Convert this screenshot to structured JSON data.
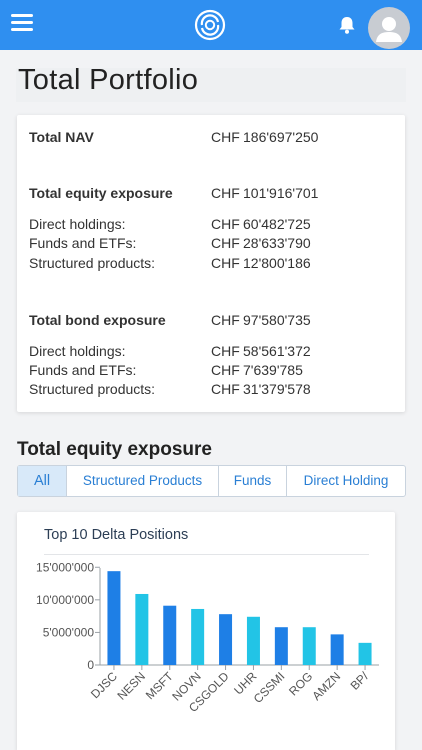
{
  "header": {
    "menu_icon": "hamburger-menu-icon",
    "logo_icon": "ring-logo-icon",
    "bell_icon": "bell-icon",
    "avatar_icon": "user-avatar-icon",
    "brand_color": "#2f8ff0"
  },
  "page_title": "Total Portfolio",
  "nav_summary": {
    "total_nav": {
      "label": "Total NAV",
      "currency": "CHF",
      "value": "186'697'250"
    },
    "equity": {
      "label": "Total equity exposure",
      "currency": "CHF",
      "value": "101'916'701",
      "items": [
        {
          "label": "Direct holdings:",
          "currency": "CHF",
          "value": "60'482'725"
        },
        {
          "label": "Funds and ETFs:",
          "currency": "CHF",
          "value": "28'633'790"
        },
        {
          "label": "Structured products:",
          "currency": "CHF",
          "value": "12'800'186"
        }
      ]
    },
    "bond": {
      "label": "Total bond exposure",
      "currency": "CHF",
      "value": "97'580'735",
      "items": [
        {
          "label": "Direct holdings:",
          "currency": "CHF",
          "value": "58'561'372"
        },
        {
          "label": "Funds and ETFs:",
          "currency": "CHF",
          "value": "7'639'785"
        },
        {
          "label": "Structured products:",
          "currency": "CHF",
          "value": "31'379'578"
        }
      ]
    }
  },
  "exposure_section": {
    "title": "Total equity exposure",
    "tabs": [
      {
        "label": "All",
        "active": true
      },
      {
        "label": "Structured Products",
        "active": false
      },
      {
        "label": "Funds",
        "active": false
      },
      {
        "label": "Direct Holding",
        "active": false
      }
    ]
  },
  "chart_card": {
    "title": "Top 10 Delta Positions"
  },
  "chart_data": {
    "type": "bar",
    "title": "Top 10 Delta Positions",
    "categories": [
      "DJSC",
      "NESN",
      "MSFT",
      "NOVN",
      "CSGOLD",
      "UHR",
      "CSSMI",
      "ROG",
      "AMZN",
      "BP/"
    ],
    "values": [
      14400000,
      10900000,
      9100000,
      8600000,
      7800000,
      7400000,
      5800000,
      5800000,
      4700000,
      3400000
    ],
    "ytick_labels": [
      "0",
      "5'000'000",
      "10'000'000",
      "15'000'000"
    ],
    "yticks": [
      0,
      5000000,
      10000000,
      15000000
    ],
    "ylim": [
      0,
      15500000
    ],
    "colors": [
      "#1e7fe6",
      "#22c4e6"
    ],
    "grid": false
  }
}
